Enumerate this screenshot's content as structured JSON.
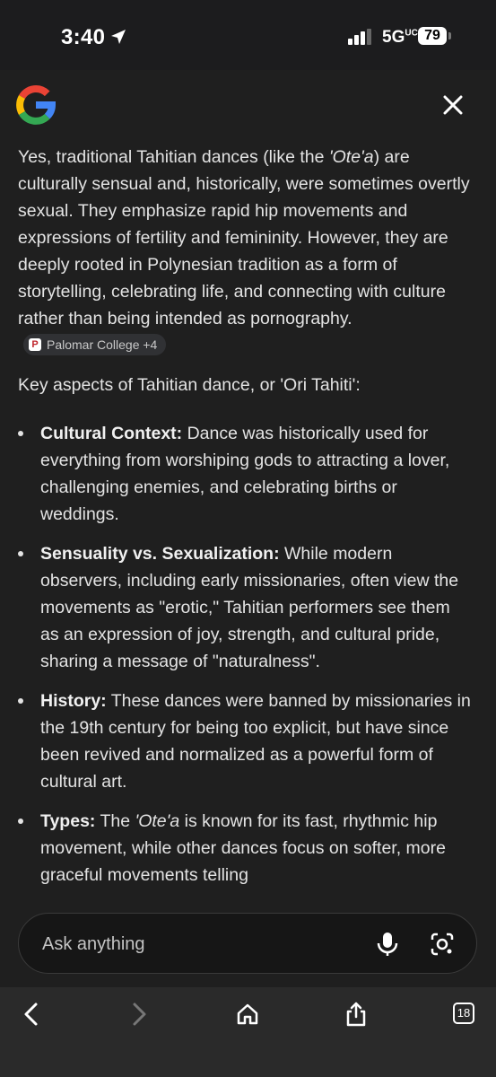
{
  "status_bar": {
    "time": "3:40",
    "network": "5G",
    "network_sup": "UC",
    "battery": "79"
  },
  "header": {
    "logo_icon": "google-g-icon",
    "close_icon": "close-icon"
  },
  "answer": {
    "paragraph1_a": "Yes, traditional Tahitian dances (like the ",
    "paragraph1_italic": "'Ote'a",
    "paragraph1_b": ") are culturally sensual and, historically, were sometimes overtly sexual. They emphasize rapid hip movements and expressions of fertility and femininity. However, they are deeply rooted in Polynesian tradition as a form of storytelling, celebrating life, and connecting with culture rather than being intended as pornography.",
    "source_chip": "Palomar College +4",
    "paragraph2": "Key aspects of Tahitian dance, or 'Ori Tahiti':",
    "bullets": [
      {
        "title": "Cultural Context:",
        "text": " Dance was historically used for everything from worshiping gods to attracting a lover, challenging enemies, and celebrating births or weddings."
      },
      {
        "title": "Sensuality vs. Sexualization:",
        "text": " While modern observers, including early missionaries, often view the movements as \"erotic,\" Tahitian performers see them as an expression of joy, strength, and cultural pride, sharing a message of \"naturalness\"."
      },
      {
        "title": "History:",
        "text": " These dances were banned by missionaries in the 19th century for being too explicit, but have since been revived and normalized as a powerful form of cultural art."
      },
      {
        "title": "Types:",
        "text_pre": " The ",
        "text_italic": "'Ote'a",
        "text": " is known for its fast, rhythmic hip movement, while other dances focus on softer, more graceful movements telling"
      }
    ]
  },
  "ask_bar": {
    "placeholder": "Ask anything",
    "mic_icon": "microphone-icon",
    "lens_icon": "camera-lens-icon"
  },
  "toolbar": {
    "tab_count": "18"
  }
}
